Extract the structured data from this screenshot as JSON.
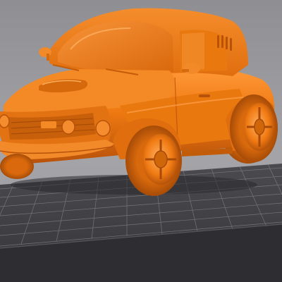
{
  "viewport": {
    "model_name": "",
    "model_color": "#f07a12",
    "model_shadow_color": "#b8520a",
    "model_highlight_color": "#ffa94e",
    "background_color": "#9a9a9e",
    "bed_color": "#3e3e42",
    "bed_grid_color": "#8a8a8e",
    "bed_edge_color": "#26262a"
  }
}
